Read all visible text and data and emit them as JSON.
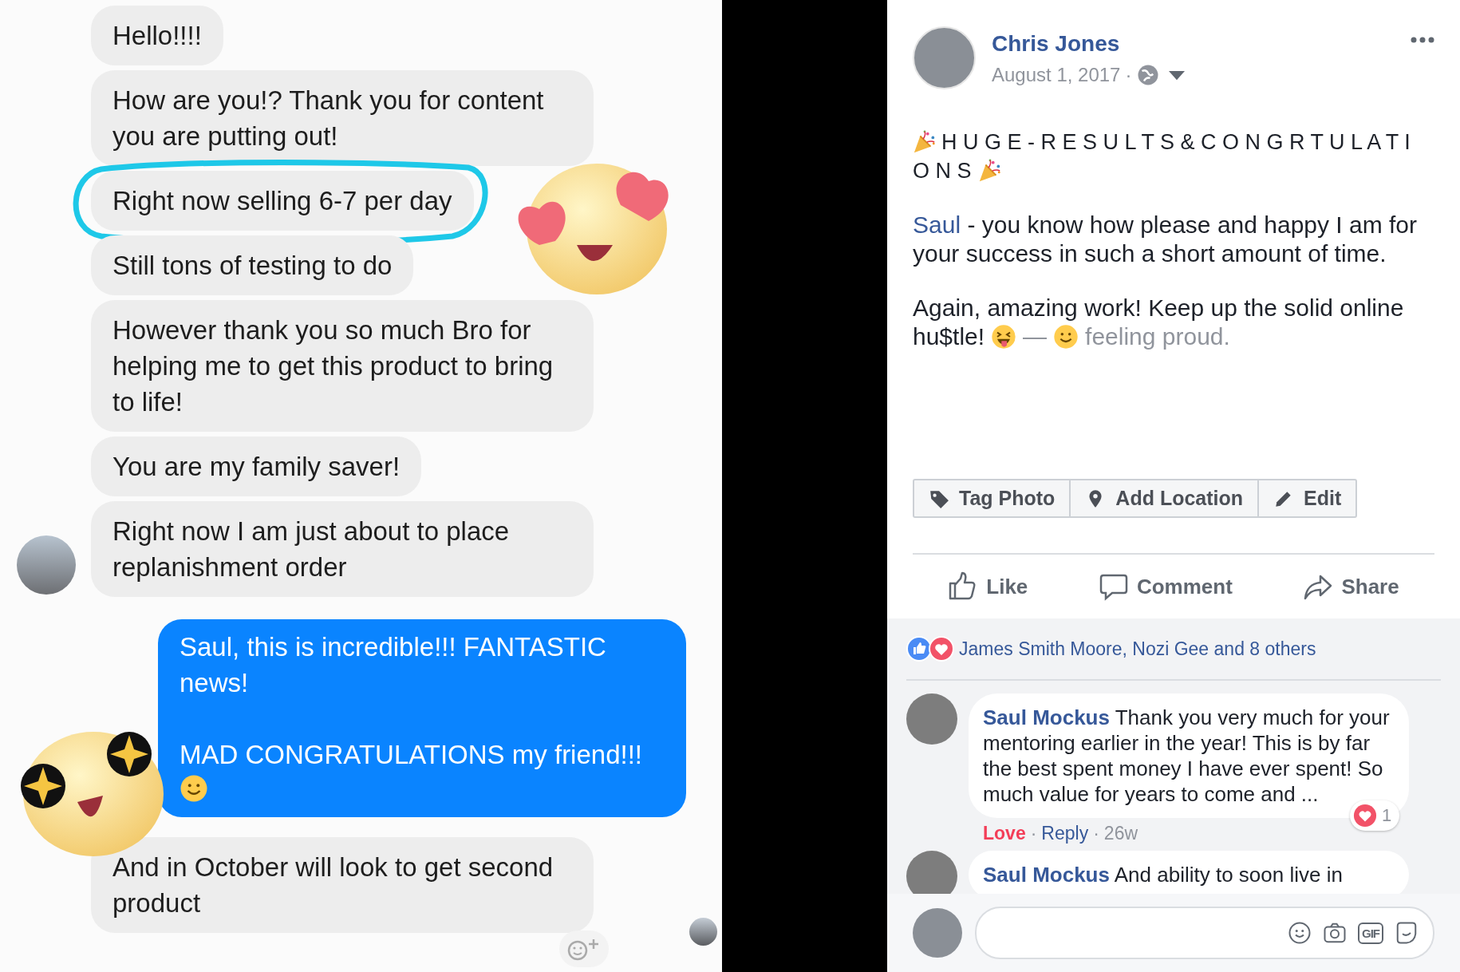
{
  "chat": {
    "messages": [
      {
        "kind": "incoming",
        "text": "Hello!!!!",
        "circled": false
      },
      {
        "kind": "incoming",
        "text": "How are you!? Thank you for content you are putting out!",
        "circled": false
      },
      {
        "kind": "incoming",
        "text": "Right now selling 6-7 per day",
        "circled": true
      },
      {
        "kind": "incoming",
        "text": "Still tons of testing to do",
        "circled": false
      },
      {
        "kind": "incoming",
        "text": "However thank you so much Bro for helping me to get this product to bring to life!",
        "circled": false
      },
      {
        "kind": "incoming",
        "text": "You are my family saver!",
        "circled": false
      },
      {
        "kind": "incoming",
        "text": "Right now I am just about to place replanishment order",
        "circled": false,
        "avatar": true
      },
      {
        "kind": "outgoing",
        "text": "Saul, this is incredible!!! FANTASTIC news!\n\nMAD CONGRATULATIONS my friend!!!",
        "circled": false,
        "emoji": true
      },
      {
        "kind": "incoming",
        "text": "And in October will look to get second product",
        "circled": false
      }
    ]
  },
  "post": {
    "author": "Chris Jones",
    "date": "August 1, 2017",
    "separator": "·",
    "heading_lines": [
      "H U G E - R E S U L T S & C O N G R T U L A T I",
      "O N S"
    ],
    "mention": "Saul",
    "paragraph_1": " - you know how please and happy I am for your success in such a short amount of time.",
    "paragraph_2": "Again, amazing work! Keep up the solid online",
    "paragraph_2_end": "hu$tle!",
    "dash": "—",
    "feeling": "feeling proud.",
    "buttons": [
      "Tag Photo",
      "Add Location",
      "Edit"
    ],
    "actions": [
      "Like",
      "Comment",
      "Share"
    ],
    "reactions_summary": "James Smith Moore, Nozi Gee and 8 others",
    "comments": [
      {
        "author": "Saul Mockus",
        "text": "Thank you very much for your mentoring earlier in the year! This is by far the best spent money I have ever spent! So much value for years to come and ...",
        "love": "Love",
        "loved": true,
        "reply": "Reply",
        "time": "26w",
        "reaction_count": "1"
      },
      {
        "author": "Saul Mockus",
        "text": "And ability to soon live in"
      }
    ],
    "composer": {
      "gif": "GIF"
    }
  }
}
